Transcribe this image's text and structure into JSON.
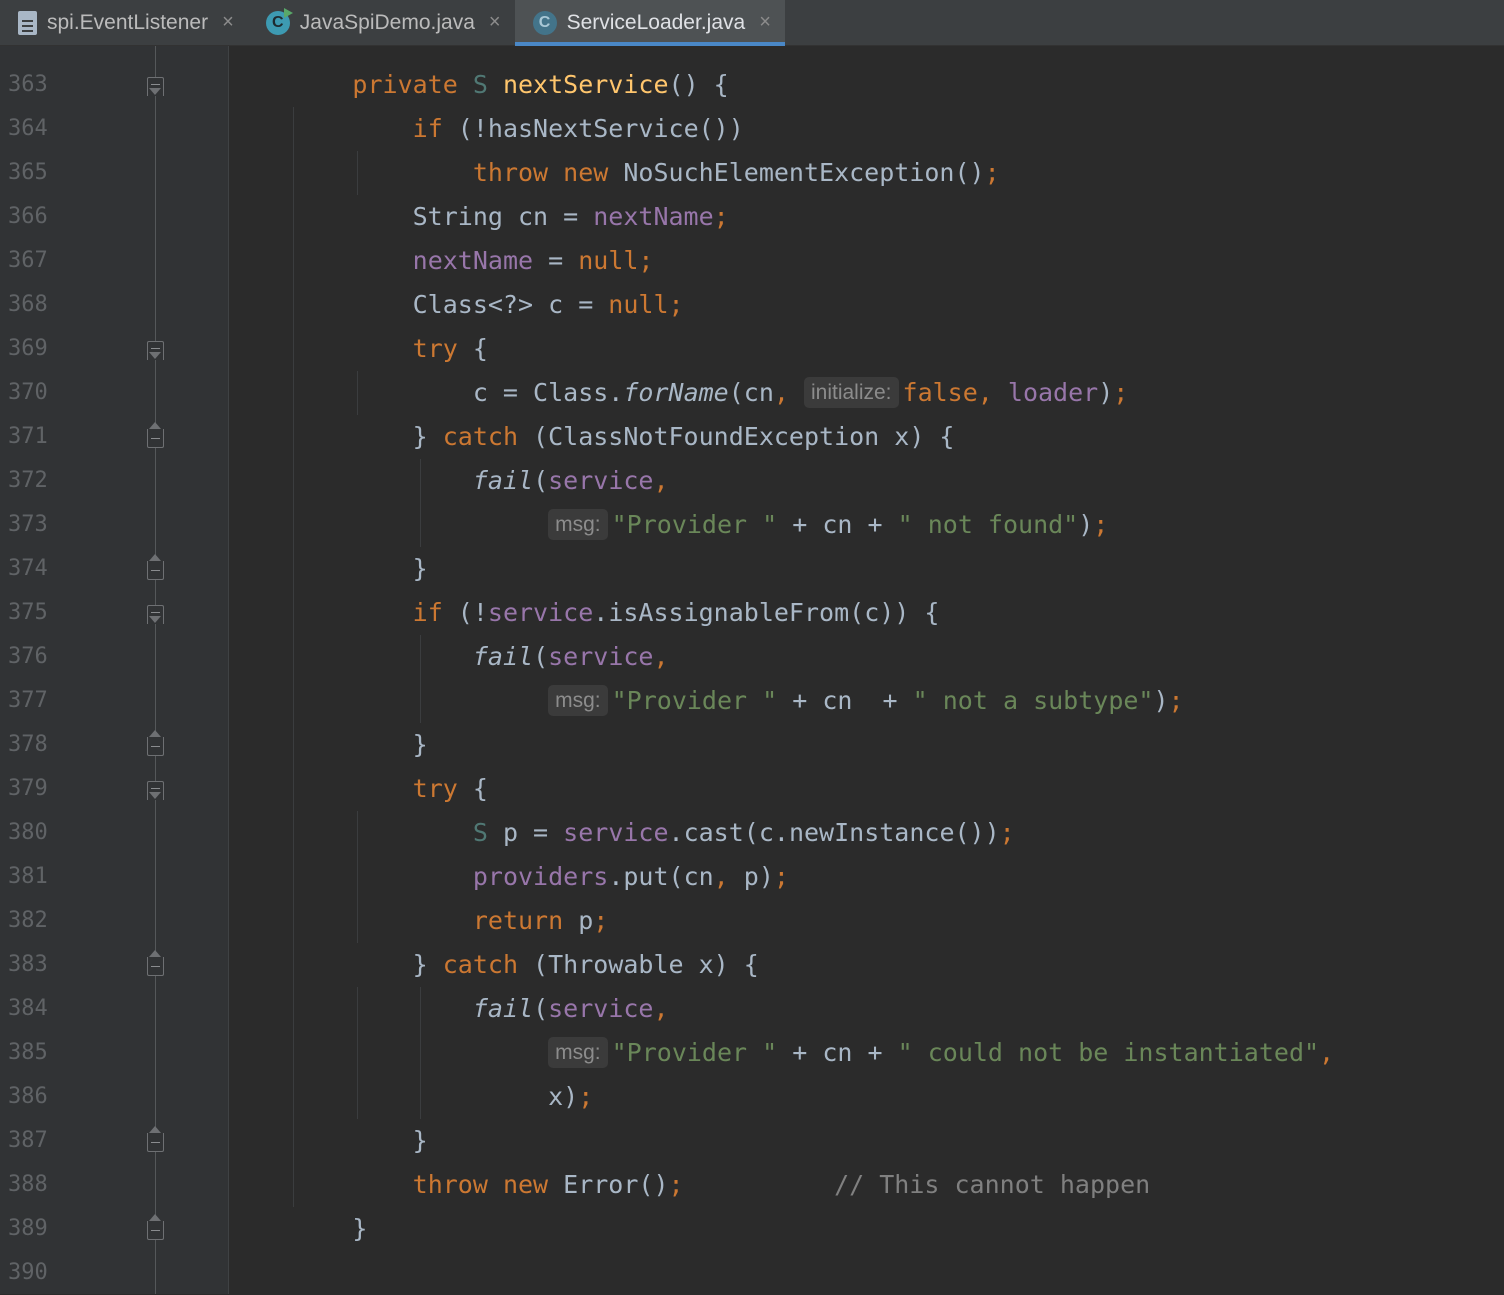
{
  "tabs": [
    {
      "label": "spi.EventListener",
      "icon": "file-icon",
      "active": false
    },
    {
      "label": "JavaSpiDemo.java",
      "icon": "java-class-run-icon",
      "active": false
    },
    {
      "label": "ServiceLoader.java",
      "icon": "java-class-library-icon",
      "active": true
    }
  ],
  "tab_close_glyph": "×",
  "class_icon_letter": "C",
  "line_numbers": [
    "363",
    "364",
    "365",
    "366",
    "367",
    "368",
    "369",
    "370",
    "371",
    "372",
    "373",
    "374",
    "375",
    "376",
    "377",
    "378",
    "379",
    "380",
    "381",
    "382",
    "383",
    "384",
    "385",
    "386",
    "387",
    "388",
    "389",
    "390"
  ],
  "code_lines": [
    [
      {
        "t": "private ",
        "c": "kw"
      },
      {
        "t": "S ",
        "c": "tp"
      },
      {
        "t": "nextService",
        "c": "mth"
      },
      {
        "t": "() {"
      }
    ],
    [
      {
        "t": "    "
      },
      {
        "t": "if ",
        "c": "kw"
      },
      {
        "t": "(!hasNextService())"
      }
    ],
    [
      {
        "t": "        "
      },
      {
        "t": "throw new ",
        "c": "kw"
      },
      {
        "t": "NoSuchElementException()"
      },
      {
        "t": ";",
        "c": "kw"
      }
    ],
    [
      {
        "t": "    String cn = "
      },
      {
        "t": "nextName",
        "c": "fld"
      },
      {
        "t": ";",
        "c": "kw"
      }
    ],
    [
      {
        "t": "    "
      },
      {
        "t": "nextName",
        "c": "fld"
      },
      {
        "t": " = "
      },
      {
        "t": "null;",
        "c": "kw"
      }
    ],
    [
      {
        "t": "    Class<?> c = "
      },
      {
        "t": "null;",
        "c": "kw"
      }
    ],
    [
      {
        "t": "    "
      },
      {
        "t": "try ",
        "c": "kw"
      },
      {
        "t": "{"
      }
    ],
    [
      {
        "t": "        c = Class."
      },
      {
        "t": "forName",
        "c": "it"
      },
      {
        "t": "(cn"
      },
      {
        "t": ", ",
        "c": "kw"
      },
      {
        "hint": "initialize:"
      },
      {
        "t": "false, ",
        "c": "kw"
      },
      {
        "t": "loader",
        "c": "fld"
      },
      {
        "t": ")"
      },
      {
        "t": ";",
        "c": "kw"
      }
    ],
    [
      {
        "t": "    } "
      },
      {
        "t": "catch ",
        "c": "kw"
      },
      {
        "t": "(ClassNotFoundException x) {"
      }
    ],
    [
      {
        "t": "        "
      },
      {
        "t": "fail",
        "c": "it"
      },
      {
        "t": "("
      },
      {
        "t": "service",
        "c": "fld"
      },
      {
        "t": ",",
        "c": "kw"
      }
    ],
    [
      {
        "t": "             "
      },
      {
        "hint": "msg:"
      },
      {
        "t": "\"Provider \"",
        "c": "str"
      },
      {
        "t": " + cn + "
      },
      {
        "t": "\" not found\"",
        "c": "str"
      },
      {
        "t": ")"
      },
      {
        "t": ";",
        "c": "kw"
      }
    ],
    [
      {
        "t": "    }"
      }
    ],
    [
      {
        "t": "    "
      },
      {
        "t": "if ",
        "c": "kw"
      },
      {
        "t": "(!"
      },
      {
        "t": "service",
        "c": "fld"
      },
      {
        "t": ".isAssignableFrom(c)) {"
      }
    ],
    [
      {
        "t": "        "
      },
      {
        "t": "fail",
        "c": "it"
      },
      {
        "t": "("
      },
      {
        "t": "service",
        "c": "fld"
      },
      {
        "t": ",",
        "c": "kw"
      }
    ],
    [
      {
        "t": "             "
      },
      {
        "hint": "msg:"
      },
      {
        "t": "\"Provider \"",
        "c": "str"
      },
      {
        "t": " + cn  + "
      },
      {
        "t": "\" not a subtype\"",
        "c": "str"
      },
      {
        "t": ")"
      },
      {
        "t": ";",
        "c": "kw"
      }
    ],
    [
      {
        "t": "    }"
      }
    ],
    [
      {
        "t": "    "
      },
      {
        "t": "try ",
        "c": "kw"
      },
      {
        "t": "{"
      }
    ],
    [
      {
        "t": "        "
      },
      {
        "t": "S ",
        "c": "tp"
      },
      {
        "t": "p = "
      },
      {
        "t": "service",
        "c": "fld"
      },
      {
        "t": ".cast(c.newInstance())"
      },
      {
        "t": ";",
        "c": "kw"
      }
    ],
    [
      {
        "t": "        "
      },
      {
        "t": "providers",
        "c": "fld"
      },
      {
        "t": ".put(cn"
      },
      {
        "t": ", ",
        "c": "kw"
      },
      {
        "t": "p)"
      },
      {
        "t": ";",
        "c": "kw"
      }
    ],
    [
      {
        "t": "        "
      },
      {
        "t": "return ",
        "c": "kw"
      },
      {
        "t": "p"
      },
      {
        "t": ";",
        "c": "kw"
      }
    ],
    [
      {
        "t": "    } "
      },
      {
        "t": "catch ",
        "c": "kw"
      },
      {
        "t": "(Throwable x) {"
      }
    ],
    [
      {
        "t": "        "
      },
      {
        "t": "fail",
        "c": "it"
      },
      {
        "t": "("
      },
      {
        "t": "service",
        "c": "fld"
      },
      {
        "t": ",",
        "c": "kw"
      }
    ],
    [
      {
        "t": "             "
      },
      {
        "hint": "msg:"
      },
      {
        "t": "\"Provider \"",
        "c": "str"
      },
      {
        "t": " + cn + "
      },
      {
        "t": "\" could not be instantiated\"",
        "c": "str"
      },
      {
        "t": ",",
        "c": "kw"
      }
    ],
    [
      {
        "t": "             x)"
      },
      {
        "t": ";",
        "c": "kw"
      }
    ],
    [
      {
        "t": "    }"
      }
    ],
    [
      {
        "t": "    "
      },
      {
        "t": "throw new ",
        "c": "kw"
      },
      {
        "t": "Error()"
      },
      {
        "t": ";",
        "c": "kw"
      },
      {
        "t": "          // This cannot happen",
        "c": "cmt"
      }
    ],
    [
      {
        "t": "}"
      }
    ],
    []
  ],
  "colors": {
    "background": "#2b2b2b",
    "gutter": "#313335",
    "keyword": "#cc7832",
    "field": "#9876aa",
    "method": "#ffc66d",
    "string": "#6a8759",
    "type_param": "#507874",
    "comment": "#808080",
    "tab_accent": "#4a88c7"
  }
}
